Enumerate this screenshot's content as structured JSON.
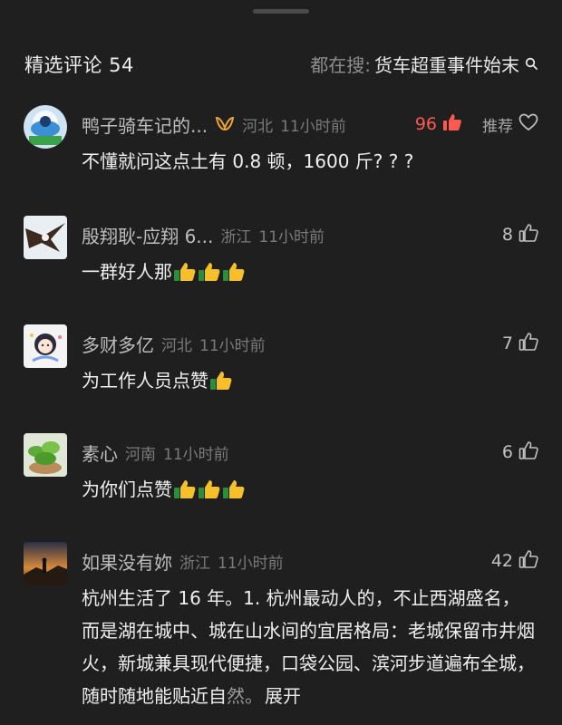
{
  "header": {
    "title": "精选评论 54",
    "search_prefix": "都在搜:",
    "search_term": "货车超重事件始末"
  },
  "comments": [
    {
      "username": "鸭子骑车记的...",
      "location": "河北",
      "time": "11小时前",
      "likes": "96",
      "recommend": "推荐",
      "text": "不懂就问这点土有 0.8 顿，1600 斤? ? ?"
    },
    {
      "username": "殷翔耿-应翔 6...",
      "location": "浙江",
      "time": "11小时前",
      "likes": "8",
      "text": "一群好人那",
      "emoji_count": 3
    },
    {
      "username": "多财多亿",
      "location": "河北",
      "time": "11小时前",
      "likes": "7",
      "text": "为工作人员点赞",
      "emoji_count": 1
    },
    {
      "username": "素心",
      "location": "河南",
      "time": "11小时前",
      "likes": "6",
      "text": "为你们点赞",
      "emoji_count": 3
    },
    {
      "username": "如果没有妳",
      "location": "浙江",
      "time": "11小时前",
      "likes": "42",
      "text": "杭州生活了 16 年。1. 杭州最动人的，不止西湖盛名，而是湖在城中、城在山水间的宜居格局：老城保留市井烟火，新城兼具现代便捷，口袋公园、滨河步道遍布全城，随时随地能贴近自",
      "text_fade": "然。",
      "expand_label": "展开"
    }
  ],
  "icons": {
    "search": "search-icon",
    "like": "thumbs-up-icon",
    "liked": "thumbs-up-filled-icon",
    "heart": "heart-icon",
    "badge": "fan-badge-icon",
    "emoji": "thumbs-up-emoji"
  },
  "colors": {
    "background": "#1f1f1f",
    "hot_like": "#ff5a4f",
    "badge": "#f2a23a"
  }
}
